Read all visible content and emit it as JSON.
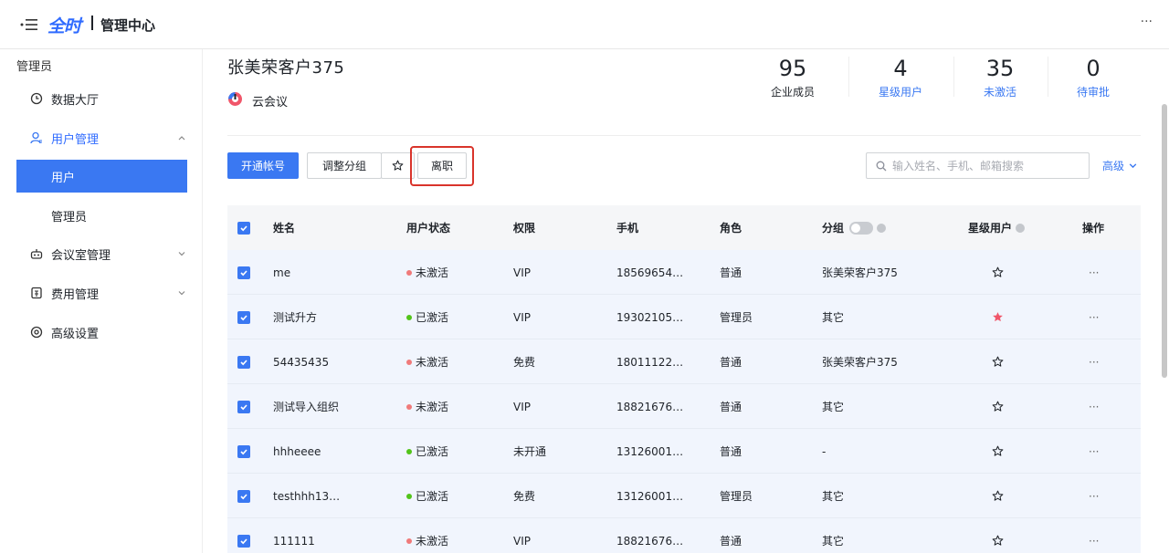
{
  "header": {
    "logo_text": "全时",
    "title": "管理中心",
    "more_label": "···"
  },
  "sidebar": {
    "role_label": "管理员",
    "items": [
      {
        "label": "数据大厅",
        "icon": "clock-icon"
      },
      {
        "label": "用户管理",
        "icon": "user-icon",
        "expanded": true
      },
      {
        "label": "会议室管理",
        "icon": "robot-icon"
      },
      {
        "label": "费用管理",
        "icon": "bill-icon"
      },
      {
        "label": "高级设置",
        "icon": "settings-icon"
      }
    ],
    "subitems": [
      {
        "label": "用户",
        "active": true
      },
      {
        "label": "管理员",
        "active": false
      }
    ]
  },
  "org": {
    "name": "张美荣客户375",
    "product": "云会议"
  },
  "stats": [
    {
      "value": "95",
      "label": "企业成员",
      "color": "#1f2329"
    },
    {
      "value": "4",
      "label": "星级用户",
      "color": "#3a78f2"
    },
    {
      "value": "35",
      "label": "未激活",
      "color": "#3a78f2"
    },
    {
      "value": "0",
      "label": "待审批",
      "color": "#3a78f2"
    }
  ],
  "toolbar": {
    "open_account": "开通帐号",
    "adjust_group": "调整分组",
    "resign": "离职",
    "search_placeholder": "输入姓名、手机、邮箱搜索",
    "advanced": "高级"
  },
  "table": {
    "columns": [
      "姓名",
      "用户状态",
      "权限",
      "手机",
      "角色",
      "分组",
      "星级用户",
      "操作"
    ],
    "rows": [
      {
        "name": "me",
        "status": "未激活",
        "active": false,
        "permission": "VIP",
        "phone": "18569654…",
        "role": "普通",
        "group": "张美荣客户375",
        "starred": false
      },
      {
        "name": "测试升方",
        "status": "已激活",
        "active": true,
        "permission": "VIP",
        "phone": "19302105…",
        "role": "管理员",
        "group": "其它",
        "starred": true
      },
      {
        "name": "54435435",
        "status": "未激活",
        "active": false,
        "permission": "免费",
        "phone": "18011122…",
        "role": "普通",
        "group": "张美荣客户375",
        "starred": false
      },
      {
        "name": "测试导入组织",
        "status": "未激活",
        "active": false,
        "permission": "VIP",
        "phone": "18821676…",
        "role": "普通",
        "group": "其它",
        "starred": false
      },
      {
        "name": "hhheeee",
        "status": "已激活",
        "active": true,
        "permission": "未开通",
        "phone": "13126001…",
        "role": "普通",
        "group": "-",
        "starred": false
      },
      {
        "name": "testhhh13…",
        "status": "已激活",
        "active": true,
        "permission": "免费",
        "phone": "13126001…",
        "role": "管理员",
        "group": "其它",
        "starred": false
      },
      {
        "name": "111111",
        "status": "未激活",
        "active": false,
        "permission": "VIP",
        "phone": "18821676…",
        "role": "普通",
        "group": "其它",
        "starred": false
      }
    ],
    "more_label": "···"
  },
  "colors": {
    "accent": "#3a78f2",
    "inactive_dot": "#f07a7a",
    "active_dot": "#52c41a",
    "star_filled": "#f0566a",
    "highlight": "#d9342b"
  }
}
